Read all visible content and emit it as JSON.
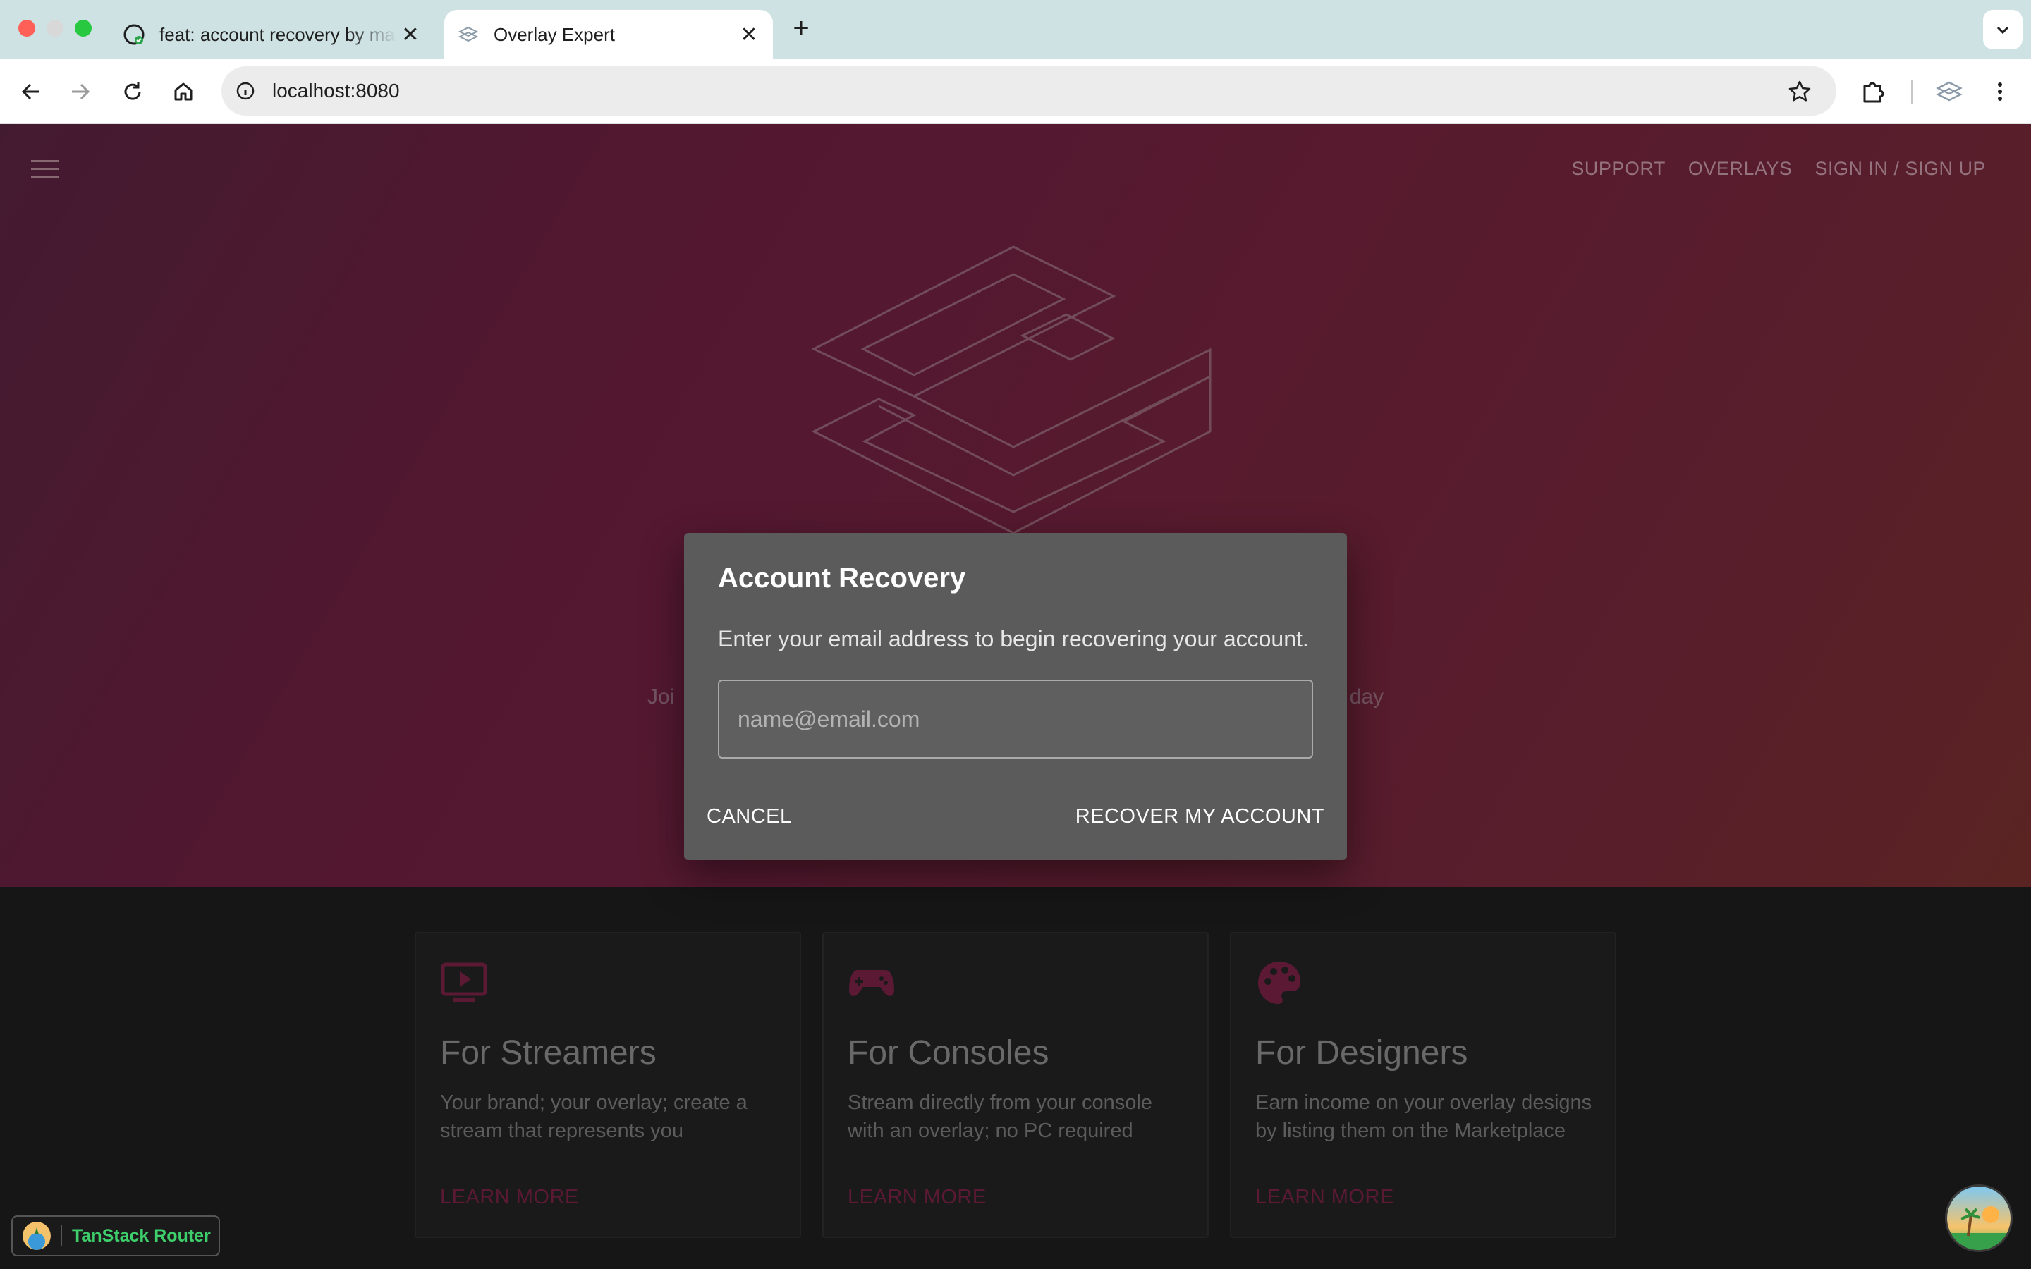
{
  "browser": {
    "tabs": [
      {
        "title": "feat: account recovery by mar",
        "active": false,
        "favicon": "github-icon"
      },
      {
        "title": "Overlay Expert",
        "active": true,
        "favicon": "overlay-expert-icon"
      }
    ],
    "url": "localhost:8080"
  },
  "nav": {
    "support": "SUPPORT",
    "overlays": "OVERLAYS",
    "signin": "SIGN IN / SIGN UP"
  },
  "hero": {
    "tagline_left": "Joi",
    "tagline_right": "day"
  },
  "dialog": {
    "title": "Account Recovery",
    "text": "Enter your email address to begin recovering your account.",
    "email_placeholder": "name@email.com",
    "email_value": "",
    "cancel": "CANCEL",
    "recover": "RECOVER MY ACCOUNT"
  },
  "features": [
    {
      "icon": "video-player-icon",
      "title": "For Streamers",
      "desc": "Your brand; your overlay; create a stream that represents you",
      "link": "LEARN MORE"
    },
    {
      "icon": "gamepad-icon",
      "title": "For Consoles",
      "desc": "Stream directly from your console with an overlay; no PC required",
      "link": "LEARN MORE"
    },
    {
      "icon": "palette-icon",
      "title": "For Designers",
      "desc": "Earn income on your overlay designs by listing them on the Marketplace",
      "link": "LEARN MORE"
    }
  ],
  "devtools": {
    "label": "TanStack Router"
  },
  "colors": {
    "accent": "#8a2450",
    "dialog_bg": "#5b5b5b",
    "devtools_green": "#3ecf6c"
  }
}
